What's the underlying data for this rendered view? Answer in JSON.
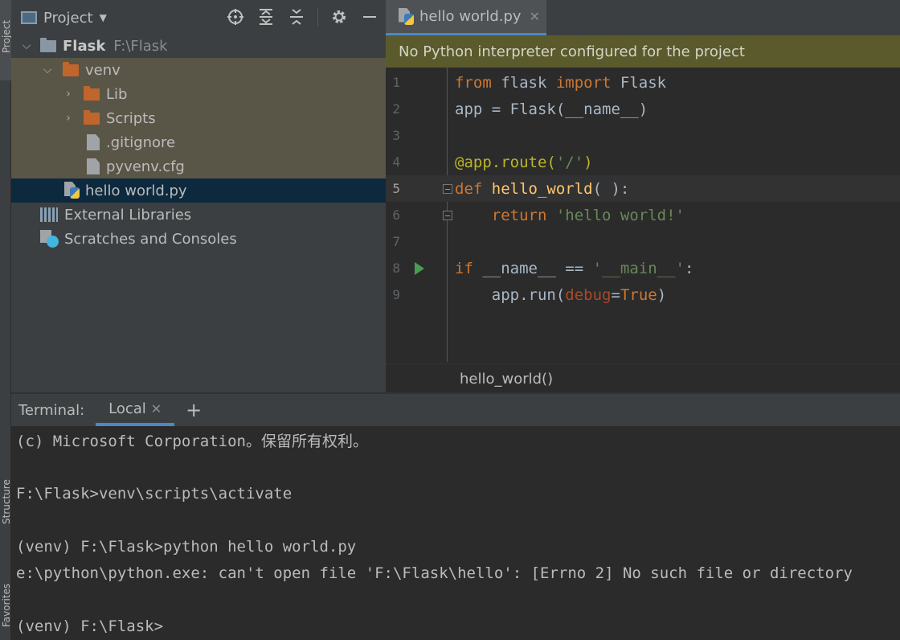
{
  "side_tabs": {
    "project": "Project",
    "structure": "Structure",
    "favorites": "Favorites"
  },
  "project_panel": {
    "title": "Project",
    "tree": {
      "root_name": "Flask",
      "root_path": "F:\\Flask",
      "venv": "venv",
      "lib": "Lib",
      "scripts": "Scripts",
      "gitignore": ".gitignore",
      "pyvenv": "pyvenv.cfg",
      "hello_file": "hello world.py",
      "external_libraries": "External Libraries",
      "scratches": "Scratches and Consoles"
    }
  },
  "editor": {
    "tab_label": "hello world.py",
    "banner": "No Python interpreter configured for the project",
    "line_numbers": [
      "1",
      "2",
      "3",
      "4",
      "5",
      "6",
      "7",
      "8",
      "9"
    ],
    "code": {
      "l1_kw1": "from",
      "l1_mod": " flask ",
      "l1_kw2": "import",
      "l1_name": " Flask",
      "l2": "app = Flask(__name__)",
      "l4_dec": "@app.route(",
      "l4_str": "'/'",
      "l4_end": ")",
      "l5_kw": "def",
      "l5_fn": " hello_world",
      "l5_rest": "( ):",
      "l6_indent": "    ",
      "l6_kw": "return",
      "l6_str": " 'hello world!'",
      "l8_kw": "if",
      "l8_mid": " __name__ == ",
      "l8_str": "'__main__'",
      "l8_end": ":",
      "l9_start": "    app.run(",
      "l9_param": "debug",
      "l9_eq": "=",
      "l9_true": "True",
      "l9_end": ")"
    },
    "breadcrumb": "hello_world()",
    "current_line": "5"
  },
  "terminal": {
    "label": "Terminal:",
    "tab_label": "Local",
    "add_label": "+",
    "lines": [
      "(c) Microsoft Corporation。保留所有权利。",
      "",
      "F:\\Flask>venv\\scripts\\activate",
      "",
      "(venv) F:\\Flask>python hello world.py",
      "e:\\python\\python.exe: can't open file 'F:\\Flask\\hello': [Errno 2] No such file or directory",
      "",
      "(venv) F:\\Flask>"
    ]
  },
  "colors": {
    "keyword": "#cc7832",
    "string": "#6a8759",
    "function": "#ffc66d",
    "decorator": "#bbb529",
    "parameter": "#aa4926",
    "accent": "#4a88c7",
    "banner_bg": "#5a5a2c"
  }
}
